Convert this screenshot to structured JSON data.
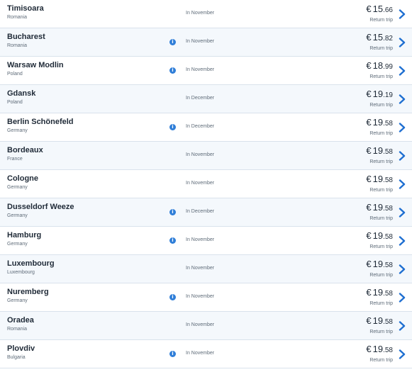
{
  "results": [
    {
      "city": "Timisoara",
      "country": "Romania",
      "info": false,
      "month": "In November",
      "currency": "€",
      "price_int": "15",
      "price_dec": ".66",
      "trip": "Return trip"
    },
    {
      "city": "Bucharest",
      "country": "Romania",
      "info": true,
      "month": "In November",
      "currency": "€",
      "price_int": "15",
      "price_dec": ".82",
      "trip": "Return trip"
    },
    {
      "city": "Warsaw Modlin",
      "country": "Poland",
      "info": true,
      "month": "In November",
      "currency": "€",
      "price_int": "18",
      "price_dec": ".99",
      "trip": "Return trip"
    },
    {
      "city": "Gdansk",
      "country": "Poland",
      "info": false,
      "month": "In December",
      "currency": "€",
      "price_int": "19",
      "price_dec": ".19",
      "trip": "Return trip"
    },
    {
      "city": "Berlin Schönefeld",
      "country": "Germany",
      "info": true,
      "month": "In December",
      "currency": "€",
      "price_int": "19",
      "price_dec": ".58",
      "trip": "Return trip"
    },
    {
      "city": "Bordeaux",
      "country": "France",
      "info": false,
      "month": "In November",
      "currency": "€",
      "price_int": "19",
      "price_dec": ".58",
      "trip": "Return trip"
    },
    {
      "city": "Cologne",
      "country": "Germany",
      "info": false,
      "month": "In November",
      "currency": "€",
      "price_int": "19",
      "price_dec": ".58",
      "trip": "Return trip"
    },
    {
      "city": "Dusseldorf Weeze",
      "country": "Germany",
      "info": true,
      "month": "In December",
      "currency": "€",
      "price_int": "19",
      "price_dec": ".58",
      "trip": "Return trip"
    },
    {
      "city": "Hamburg",
      "country": "Germany",
      "info": true,
      "month": "In November",
      "currency": "€",
      "price_int": "19",
      "price_dec": ".58",
      "trip": "Return trip"
    },
    {
      "city": "Luxembourg",
      "country": "Luxembourg",
      "info": false,
      "month": "In November",
      "currency": "€",
      "price_int": "19",
      "price_dec": ".58",
      "trip": "Return trip"
    },
    {
      "city": "Nuremberg",
      "country": "Germany",
      "info": true,
      "month": "In November",
      "currency": "€",
      "price_int": "19",
      "price_dec": ".58",
      "trip": "Return trip"
    },
    {
      "city": "Oradea",
      "country": "Romania",
      "info": false,
      "month": "In November",
      "currency": "€",
      "price_int": "19",
      "price_dec": ".58",
      "trip": "Return trip"
    },
    {
      "city": "Plovdiv",
      "country": "Bulgaria",
      "info": true,
      "month": "In November",
      "currency": "€",
      "price_int": "19",
      "price_dec": ".58",
      "trip": "Return trip"
    }
  ],
  "icons": {
    "info": "info-icon",
    "chevron": "chevron-right-icon",
    "info_glyph": "i"
  },
  "colors": {
    "accent": "#2f7ed8",
    "chevron": "#1f6fd1",
    "row_alt": "#f4f8fc",
    "divider": "#d9e2ec"
  }
}
